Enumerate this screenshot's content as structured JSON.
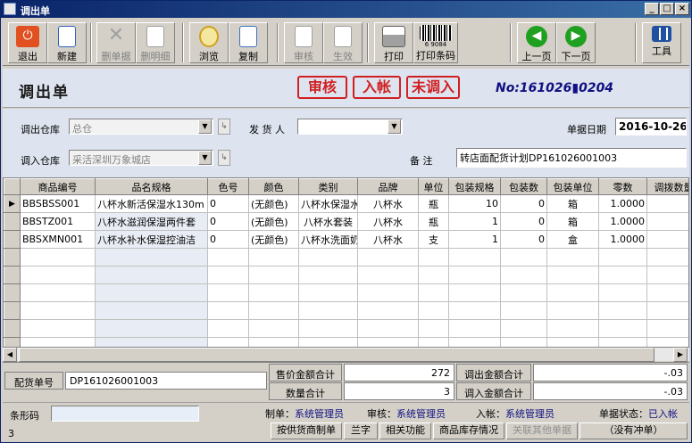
{
  "window": {
    "title": "调出单"
  },
  "toolbar": [
    {
      "id": "exit",
      "label": "退出",
      "icon": "power-icon",
      "disabled": false,
      "color": "#e05020"
    },
    {
      "id": "new",
      "label": "新建",
      "icon": "new-doc-icon",
      "disabled": false,
      "color": "#3060c0"
    },
    {
      "id": "del",
      "label": "删单据",
      "icon": "delete-x-icon",
      "disabled": true,
      "color": "#a0a0a0"
    },
    {
      "id": "deldetail",
      "label": "删明细",
      "icon": "delete-detail-icon",
      "disabled": true,
      "color": "#a0a0a0"
    },
    {
      "id": "browse",
      "label": "浏览",
      "icon": "magnifier-icon",
      "disabled": false,
      "color": "#d0a020"
    },
    {
      "id": "copy",
      "label": "复制",
      "icon": "copy-icon",
      "disabled": false,
      "color": "#4070c0"
    },
    {
      "id": "audit",
      "label": "审核",
      "icon": "audit-icon",
      "disabled": true,
      "color": "#a0a0a0"
    },
    {
      "id": "effect",
      "label": "生效",
      "icon": "effect-icon",
      "disabled": true,
      "color": "#a0a0a0"
    },
    {
      "id": "print",
      "label": "打印",
      "icon": "printer-icon",
      "disabled": false,
      "color": "#606060"
    },
    {
      "id": "barcode",
      "label": "打印条码",
      "icon": "barcode-icon",
      "disabled": false,
      "color": "#000000"
    },
    {
      "id": "prev",
      "label": "上一页",
      "icon": "arrow-left-icon",
      "disabled": false,
      "color": "#20a020"
    },
    {
      "id": "next",
      "label": "下一页",
      "icon": "arrow-right-icon",
      "disabled": false,
      "color": "#20a020"
    },
    {
      "id": "tools",
      "label": "工具",
      "icon": "tools-grid-icon",
      "disabled": false,
      "color": "#2050a0"
    }
  ],
  "barcode_number": "6 9084",
  "heading": {
    "title": "调出单",
    "stamps": [
      "审核",
      "入帐",
      "未调入"
    ],
    "doc_no": "No:161026▮0204"
  },
  "form": {
    "out_store_label": "调出仓库",
    "out_store_value": "总仓",
    "shipper_label": "发 货 人",
    "shipper_value": "",
    "date_label": "单据日期",
    "date_value": "2016-10-26",
    "in_store_label": "调入仓库",
    "in_store_value": "采活深圳万象城店",
    "note_label": "备    注",
    "note_value": "转店面配货计划DP161026001003"
  },
  "grid": {
    "columns": [
      "商品编号",
      "品名规格",
      "色号",
      "颜色",
      "类别",
      "品牌",
      "单位",
      "包装规格",
      "包装数",
      "包装单位",
      "零数",
      "调拨数量"
    ],
    "rows": [
      [
        "BBSBSS001",
        "八杯水新活保湿水130m",
        "0",
        "(无颜色)",
        "八杯水保湿水",
        "八杯水",
        "瓶",
        "10",
        "0",
        "箱",
        "1.0000",
        ""
      ],
      [
        "BBSTZ001",
        "八杯水滋润保湿两件套",
        "0",
        "(无颜色)",
        "八杯水套装",
        "八杯水",
        "瓶",
        "1",
        "0",
        "箱",
        "1.0000",
        ""
      ],
      [
        "BBSXMN001",
        "八杯水补水保湿控油洁",
        "0",
        "(无颜色)",
        "八杯水洗面奶",
        "八杯水",
        "支",
        "1",
        "0",
        "盒",
        "1.0000",
        ""
      ]
    ],
    "empty_rows": 6
  },
  "summary": {
    "dist_no_label": "配货单号",
    "dist_no_value": "DP161026001003",
    "sale_total_label": "售价金额合计",
    "sale_total_value": "272",
    "qty_total_label": "数量合计",
    "qty_total_value": "3",
    "out_total_label": "调出金额合计",
    "out_total_value": "-.03",
    "in_total_label": "调入金额合计",
    "in_total_value": "-.03"
  },
  "footer": {
    "barcode_label": "条形码",
    "barcode_value": "",
    "maker_label": "制单：",
    "maker_value": "系统管理员",
    "auditor_label": "审核：",
    "auditor_value": "系统管理员",
    "poster_label": "入帐：",
    "poster_value": "系统管理员",
    "status_label": "单据状态：",
    "status_value": "已入帐",
    "count": "3",
    "buttons": [
      "按供货商制单",
      "兰字",
      "相关功能",
      "商品库存情况",
      "关联其他单据",
      "（没有冲单）"
    ]
  }
}
